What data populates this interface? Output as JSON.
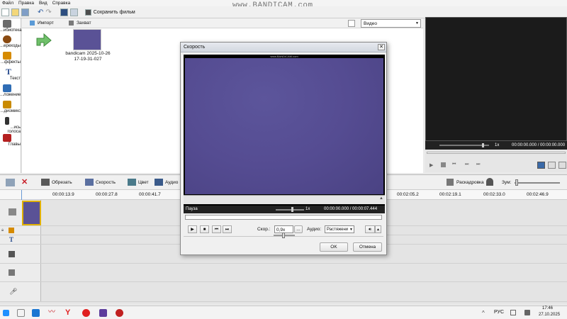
{
  "watermark": "www.BANDICAM.com",
  "menu": {
    "items": [
      "Файл",
      "Правка",
      "Вид",
      "Справка"
    ]
  },
  "toolbar": {
    "save_label": "Сохранить фильм"
  },
  "sidebar": {
    "items": [
      {
        "label": "...ибиотека",
        "icon": "library-icon",
        "color": "#6b6b6b"
      },
      {
        "label": "...ереходы",
        "icon": "transitions-icon",
        "color": "#8a4b12"
      },
      {
        "label": "...ффекты",
        "icon": "effects-icon",
        "color": "#d68b00"
      },
      {
        "label": "Текст",
        "icon": "text-icon",
        "color": "#2a4d8f"
      },
      {
        "label": "...ложение",
        "icon": "overlay-icon",
        "color": "#2f6db5"
      },
      {
        "label": "...диомикс",
        "icon": "audio-mix-icon",
        "color": "#c98a00"
      },
      {
        "label": "...ись голоса",
        "icon": "microphone-icon",
        "color": "#333333"
      },
      {
        "label": "Главы",
        "icon": "chapters-icon",
        "color": "#b42020"
      }
    ]
  },
  "library": {
    "import_label": "Импорт",
    "capture_label": "Захват",
    "filter_value": "Видео",
    "clip_name": "bandicam 2025-10-26",
    "clip_time": "17-19-31-027"
  },
  "preview": {
    "speed": "1x",
    "time": "00:00:00.000 / 00:00:00.000"
  },
  "timeline": {
    "trim_label": "Обрезать",
    "speed_label": "Скорость",
    "color_label": "Цвет",
    "audio_label": "Аудио",
    "storyboard_label": "Раскадровка",
    "zoom_label": "Зум:",
    "ruler": [
      "00:00:13.9",
      "00:00:27.8",
      "00:00:41.7",
      "00:02:05.2",
      "00:02:19.1",
      "00:02:33.0",
      "00:02:46.9"
    ]
  },
  "dialog": {
    "title": "Скорость",
    "close": "✕",
    "video_watermark": "www.BANDICAM.com",
    "status": "Пауза",
    "speed_indicator": "1x",
    "time": "00:00:00.000 / 00:00:07.444",
    "speed_label": "Скор.:",
    "speed_value": "0,9x",
    "browse_label": "...",
    "audio_label": "Аудио:",
    "audio_value": "Растяжени",
    "ok_label": "OK",
    "cancel_label": "Отмена"
  },
  "taskbar": {
    "lang": "РУС",
    "clock_time": "17:46",
    "clock_date": "27.10.2025"
  }
}
